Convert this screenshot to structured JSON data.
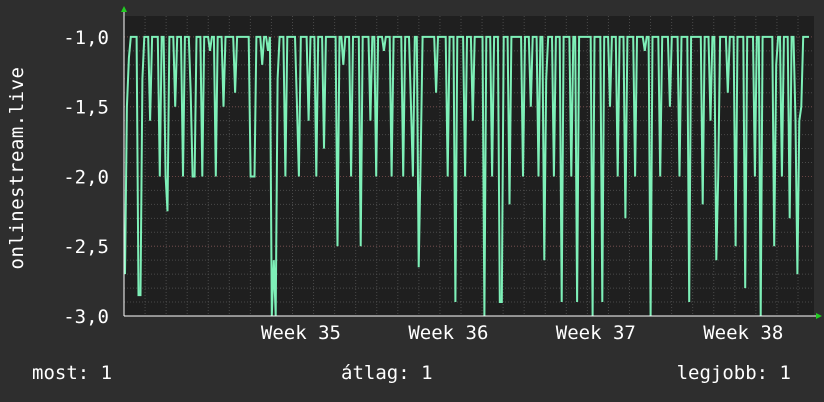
{
  "chart_data": {
    "type": "line",
    "ylabel": "onlinestream.live",
    "ylim": [
      -3.0,
      -0.85
    ],
    "yticks": [
      "-1,0",
      "-1,5",
      "-2,0",
      "-2,5",
      "-3,0"
    ],
    "ytick_values": [
      -1.0,
      -1.5,
      -2.0,
      -2.5,
      -3.0
    ],
    "xticks": [
      "Week 35",
      "Week 36",
      "Week 37",
      "Week 38"
    ],
    "xtick_values": [
      35,
      36,
      37,
      38
    ],
    "xlim": [
      34.3,
      38.98
    ],
    "grid": true,
    "colors": {
      "background": "#2e2e2e",
      "plot": "#1f1f1f",
      "line": "#7ef0b8",
      "grid": "#4a4a4a",
      "axis_arrow": "#22cc22"
    },
    "series": [
      {
        "values": [
          -2.7,
          -1.5,
          -1.15,
          -1.0,
          -1.0,
          -1.0,
          -1.0,
          -2.85,
          -2.85,
          -1.3,
          -1.0,
          -1.0,
          -1.0,
          -1.6,
          -1.0,
          -1.0,
          -1.0,
          -1.0,
          -2.0,
          -1.0,
          -1.0,
          -2.0,
          -2.25,
          -1.0,
          -1.0,
          -1.0,
          -1.5,
          -1.0,
          -1.0,
          -1.0,
          -2.0,
          -1.0,
          -1.0,
          -1.0,
          -1.4,
          -2.0,
          -2.0,
          -1.0,
          -1.0,
          -1.0,
          -2.0,
          -1.0,
          -1.0,
          -1.0,
          -1.1,
          -1.0,
          -1.0,
          -2.0,
          -1.0,
          -1.0,
          -1.0,
          -1.5,
          -1.0,
          -1.0,
          -1.0,
          -1.0,
          -1.0,
          -1.4,
          -1.0,
          -1.0,
          -1.0,
          -1.0,
          -1.0,
          -1.0,
          -1.0,
          -2.0,
          -2.0,
          -2.0,
          -1.0,
          -1.0,
          -1.0,
          -1.2,
          -1.0,
          -1.0,
          -1.1,
          -1.0,
          -3.0,
          -2.6,
          -3.0,
          -1.3,
          -1.0,
          -1.0,
          -1.0,
          -2.0,
          -1.0,
          -1.0,
          -1.0,
          -1.0,
          -1.0,
          -1.5,
          -2.0,
          -1.0,
          -1.0,
          -1.0,
          -1.0,
          -1.6,
          -1.0,
          -1.0,
          -1.0,
          -2.0,
          -1.0,
          -1.0,
          -1.0,
          -1.8,
          -1.0,
          -1.0,
          -1.0,
          -1.0,
          -1.0,
          -1.0,
          -2.5,
          -1.0,
          -1.0,
          -1.2,
          -1.0,
          -1.0,
          -1.0,
          -2.0,
          -1.0,
          -1.0,
          -1.0,
          -1.0,
          -2.5,
          -1.0,
          -1.0,
          -1.0,
          -1.0,
          -1.6,
          -1.0,
          -1.0,
          -2.0,
          -1.0,
          -1.0,
          -1.0,
          -1.1,
          -1.0,
          -1.0,
          -1.0,
          -2.0,
          -1.0,
          -1.0,
          -1.0,
          -1.0,
          -1.0,
          -2.0,
          -1.0,
          -1.0,
          -1.0,
          -1.5,
          -2.0,
          -1.0,
          -1.0,
          -2.65,
          -1.9,
          -1.0,
          -1.0,
          -1.0,
          -1.0,
          -1.0,
          -1.0,
          -1.0,
          -1.4,
          -1.0,
          -1.0,
          -1.0,
          -1.0,
          -1.0,
          -2.0,
          -1.0,
          -1.0,
          -1.0,
          -2.9,
          -1.0,
          -1.0,
          -1.0,
          -1.0,
          -2.0,
          -1.0,
          -1.0,
          -1.0,
          -1.6,
          -1.0,
          -1.0,
          -1.0,
          -1.0,
          -1.0,
          -3.0,
          -1.0,
          -1.0,
          -1.0,
          -2.0,
          -1.0,
          -1.0,
          -1.0,
          -2.9,
          -2.9,
          -1.0,
          -1.0,
          -1.0,
          -2.2,
          -1.0,
          -1.0,
          -1.0,
          -1.0,
          -1.0,
          -1.0,
          -2.0,
          -1.0,
          -1.0,
          -1.0,
          -1.5,
          -1.0,
          -1.0,
          -1.0,
          -2.0,
          -1.0,
          -1.0,
          -2.6,
          -1.3,
          -1.0,
          -1.0,
          -1.0,
          -2.0,
          -1.0,
          -1.0,
          -1.0,
          -2.9,
          -1.0,
          -1.0,
          -1.0,
          -1.0,
          -2.0,
          -1.0,
          -1.0,
          -2.9,
          -1.0,
          -1.0,
          -1.0,
          -1.0,
          -1.0,
          -1.0,
          -1.0,
          -3.0,
          -1.0,
          -1.0,
          -1.0,
          -1.0,
          -2.9,
          -1.0,
          -1.0,
          -1.0,
          -1.5,
          -1.0,
          -1.0,
          -1.0,
          -2.0,
          -1.0,
          -1.0,
          -1.0,
          -2.3,
          -1.0,
          -1.0,
          -1.0,
          -1.0,
          -2.0,
          -1.0,
          -1.0,
          -1.0,
          -1.0,
          -1.1,
          -1.0,
          -1.0,
          -3.0,
          -1.0,
          -1.0,
          -1.0,
          -1.0,
          -2.0,
          -1.0,
          -1.0,
          -1.0,
          -1.0,
          -1.5,
          -1.0,
          -1.0,
          -1.0,
          -1.0,
          -2.0,
          -1.0,
          -1.0,
          -1.0,
          -1.0,
          -2.9,
          -1.0,
          -1.0,
          -1.0,
          -1.0,
          -1.0,
          -1.0,
          -2.2,
          -1.0,
          -1.0,
          -1.0,
          -1.6,
          -1.0,
          -1.0,
          -2.6,
          -2.0,
          -1.0,
          -1.0,
          -1.0,
          -1.0,
          -1.4,
          -1.0,
          -1.0,
          -1.0,
          -2.5,
          -1.0,
          -1.0,
          -1.0,
          -1.0,
          -2.8,
          -1.0,
          -1.0,
          -1.0,
          -1.0,
          -2.0,
          -1.0,
          -1.0,
          -3.0,
          -1.0,
          -1.0,
          -1.0,
          -1.0,
          -1.0,
          -1.0,
          -2.5,
          -1.2,
          -1.0,
          -1.0,
          -2.0,
          -1.0,
          -1.0,
          -1.0,
          -2.3,
          -1.0,
          -1.0,
          -1.6,
          -2.7,
          -1.6,
          -1.5,
          -1.0,
          -1.0,
          -1.0,
          -1.0
        ]
      }
    ]
  },
  "footer": {
    "current": "most: 1",
    "average": "átlag: 1",
    "best": "legjobb: 1"
  }
}
